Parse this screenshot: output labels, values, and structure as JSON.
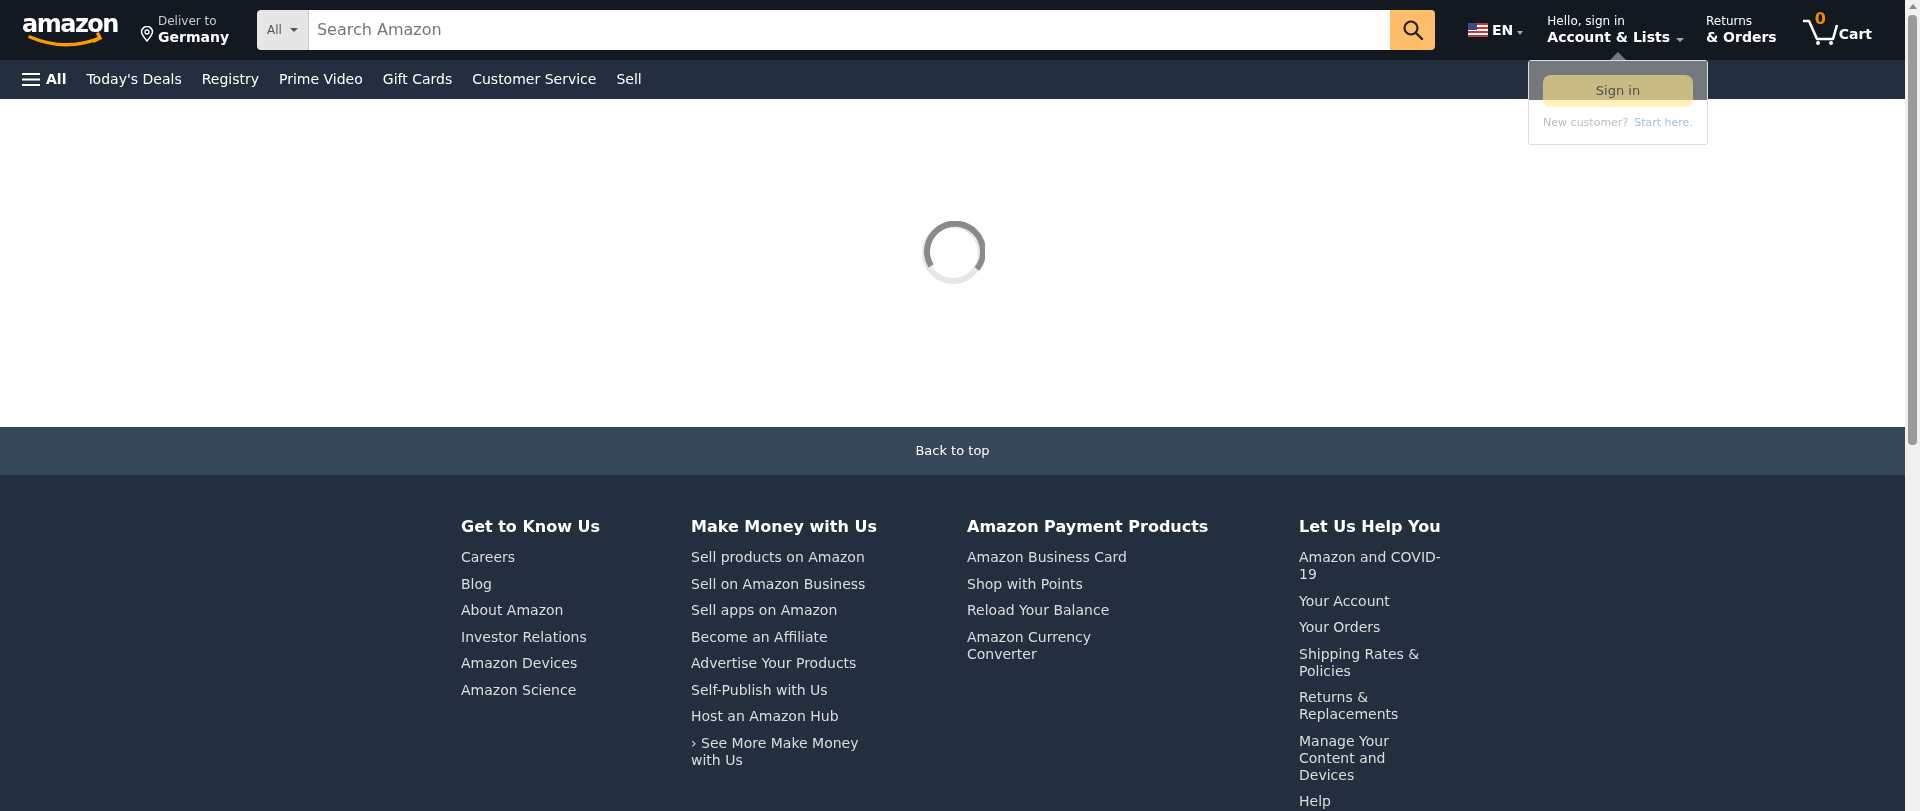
{
  "header": {
    "logo": "amazon",
    "deliver_label": "Deliver to",
    "deliver_location": "Germany",
    "search": {
      "category": "All",
      "placeholder": "Search Amazon"
    },
    "language": "EN",
    "account_greeting": "Hello, sign in",
    "account_label": "Account & Lists",
    "returns_label": "Returns",
    "orders_label": "& Orders",
    "cart_count": "0",
    "cart_label": "Cart"
  },
  "nav": {
    "menu_label": "All",
    "items": [
      "Today's Deals",
      "Registry",
      "Prime Video",
      "Gift Cards",
      "Customer Service",
      "Sell"
    ]
  },
  "signin_popover": {
    "button": "Sign in",
    "prompt": "New customer?",
    "link": "Start here."
  },
  "back_to_top": "Back to top",
  "footer": {
    "columns": [
      {
        "heading": "Get to Know Us",
        "links": [
          "Careers",
          "Blog",
          "About Amazon",
          "Investor Relations",
          "Amazon Devices",
          "Amazon Science"
        ]
      },
      {
        "heading": "Make Money with Us",
        "links": [
          "Sell products on Amazon",
          "Sell on Amazon Business",
          "Sell apps on Amazon",
          "Become an Affiliate",
          "Advertise Your Products",
          "Self-Publish with Us",
          "Host an Amazon Hub",
          "› See More Make Money with Us"
        ]
      },
      {
        "heading": "Amazon Payment Products",
        "links": [
          "Amazon Business Card",
          "Shop with Points",
          "Reload Your Balance",
          "Amazon Currency Converter"
        ]
      },
      {
        "heading": "Let Us Help You",
        "links": [
          "Amazon and COVID-19",
          "Your Account",
          "Your Orders",
          "Shipping Rates & Policies",
          "Returns & Replacements",
          "Manage Your Content and Devices",
          "Help"
        ]
      }
    ]
  }
}
